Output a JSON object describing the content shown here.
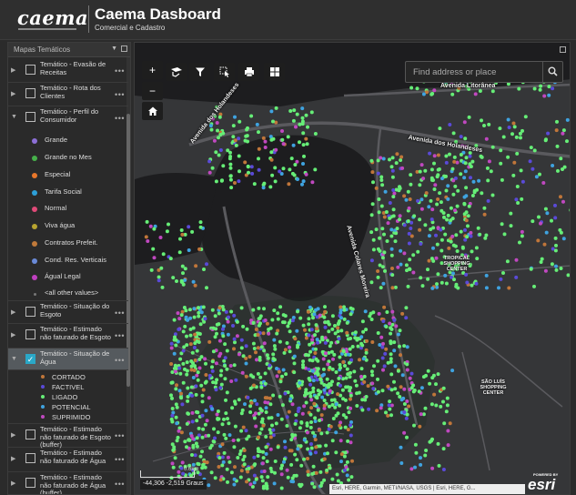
{
  "header": {
    "logo": "caema",
    "title": "Caema Dasboard",
    "subtitle": "Comercial e Cadastro"
  },
  "panel": {
    "title": "Mapas Temáticos",
    "layers": [
      {
        "label": "Temático - Evasão de Receitas"
      },
      {
        "label": "Temático - Rota dos Clientes"
      },
      {
        "label": "Temático - Perfil do Consumidor"
      },
      {
        "label": "Temático - Situação do Esgoto"
      },
      {
        "label": "Temático - Estimado não faturado de Esgoto"
      },
      {
        "label": "Temático - Situação de Água"
      },
      {
        "label": "Temático - Estimado não faturado de Esgoto (buffer)"
      },
      {
        "label": "Temático - Estimado não faturado de Água"
      },
      {
        "label": "Temático - Estimado não faturado de Água (buffer)"
      }
    ],
    "more": "•••",
    "legend_perfil": [
      {
        "label": "Grande",
        "color": "#8c6fd6"
      },
      {
        "label": "Grande no Mes",
        "color": "#46b04a"
      },
      {
        "label": "Especial",
        "color": "#e8772a"
      },
      {
        "label": "Tarifa Social",
        "color": "#2d9fd8"
      },
      {
        "label": "Normal",
        "color": "#e04a78"
      },
      {
        "label": "Viva água",
        "color": "#b8a430"
      },
      {
        "label": "Contratos Prefeit.",
        "color": "#c07a3a"
      },
      {
        "label": "Cond. Res. Verticais",
        "color": "#6a8ad8"
      },
      {
        "label": "Águal Legal",
        "color": "#c040c0"
      },
      {
        "label": "<all other values>",
        "color": "#777777"
      }
    ],
    "legend_agua": [
      {
        "label": "CORTADO",
        "color": "#c0763a"
      },
      {
        "label": "FACTIVEL",
        "color": "#5a4ad8"
      },
      {
        "label": "LIGADO",
        "color": "#66ee77"
      },
      {
        "label": "POTENCIAL",
        "color": "#3fa3e0"
      },
      {
        "label": "SUPRIMIDO",
        "color": "#c048c0"
      }
    ]
  },
  "map": {
    "search_placeholder": "Find address or place",
    "tools": [
      "+",
      "−"
    ],
    "labels": {
      "litoranea": "Avenida Litorânea",
      "holandeses_n": "Avenida dos Holandeses",
      "holandeses_e": "Avenida dos Holandeses",
      "colares": "Avenida Colares Moreira",
      "tropical": "TROPICAL\nSHOPPING\nCENTER",
      "saoluis": "SÃO LUÍS\nSHOPPING\nCENTER"
    },
    "scale": "0.6km",
    "coords": "-44,306 -2,519 Graus",
    "attribution": "Esri, HERE, Garmin, METI/NASA, USGS | Esri, HERE, G...",
    "esri_powered": "POWERED BY",
    "esri": "esri"
  }
}
